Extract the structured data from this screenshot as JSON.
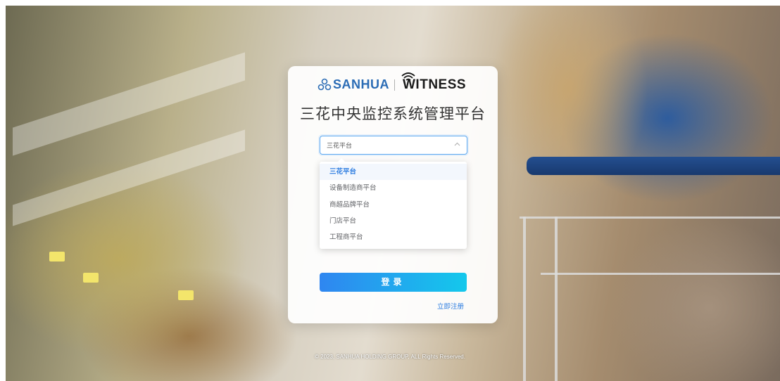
{
  "brand": {
    "sanhua": "SANHUA",
    "witness": "WITNESS"
  },
  "title": "三花中央监控系统管理平台",
  "platform_select": {
    "value": "三花平台",
    "options": [
      {
        "label": "三花平台",
        "selected": true
      },
      {
        "label": "设备制造商平台",
        "selected": false
      },
      {
        "label": "商超品牌平台",
        "selected": false
      },
      {
        "label": "门店平台",
        "selected": false
      },
      {
        "label": "工程商平台",
        "selected": false
      }
    ]
  },
  "login_button": "登录",
  "register_link": "立即注册",
  "footer": "© 2023, SANHUA HOLDING GROUP, ALL Rights Reserved.",
  "colors": {
    "accent": "#2a7be0",
    "button_start": "#2f86f0",
    "button_end": "#14c8ec",
    "brand_blue": "#2b6cb5"
  }
}
